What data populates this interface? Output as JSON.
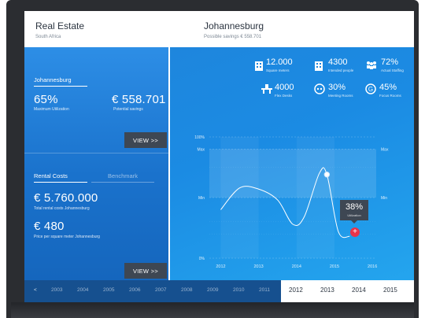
{
  "header": {
    "left_title": "Real Estate",
    "left_sub": "South Africa",
    "right_title": "Johannesburg",
    "right_sub": "Possible savings € 558.701"
  },
  "left": {
    "tab_city": "Johannesburg",
    "max_util_value": "65%",
    "max_util_caption": "Maximum Utilization",
    "savings_value": "€ 558.701",
    "savings_caption": "Potential savings",
    "view_label": "VIEW >>",
    "tab_rental": "Rental Costs",
    "tab_benchmark": "Benchmark",
    "rental_value": "€ 5.760.000",
    "rental_caption": "Total rental costs Johannesburg",
    "sqm_value": "€ 480",
    "sqm_caption": "Price per square meter Johannesburg",
    "view_label2": "VIEW >>"
  },
  "stats": {
    "square_meters_value": "12.000",
    "square_meters_caption": "Square meters",
    "people_value": "4300",
    "people_caption": "Intended people",
    "staffing_value": "72%",
    "staffing_caption": "Actual Staffing",
    "flex_value": "4000",
    "flex_caption": "Flex Desks",
    "meeting_value": "30%",
    "meeting_caption": "Meeting Rooms",
    "focus_value": "45%",
    "focus_caption": "Focus Rooms",
    "icons": [
      "building-icon",
      "building-icon",
      "people-icon",
      "desk-icon",
      "meeting-icon",
      "focus-icon"
    ]
  },
  "tooltip": {
    "value": "38%",
    "label": "Utilization"
  },
  "chart_data": {
    "type": "line",
    "x": [
      2012,
      2013,
      2014,
      2015,
      2016
    ],
    "series": [
      {
        "x": [
          2012,
          2012.5,
          2013,
          2013.5,
          2013.9,
          2014.2,
          2014.6,
          2014.8,
          2015.1,
          2015.4
        ],
        "values": [
          40,
          58,
          57,
          48,
          28,
          34,
          70,
          69,
          22,
          18
        ]
      }
    ],
    "ylim": [
      0,
      100
    ],
    "xlim": [
      2011.7,
      2016.1
    ],
    "xtick_labels": [
      "2012",
      "2013",
      "2014",
      "2015",
      "2016"
    ],
    "ytick_labels_left": [
      "100%",
      "Max",
      "Min",
      "0%"
    ],
    "ytick_labels_right": [
      "Max",
      "Min"
    ],
    "max_band": 90,
    "min_band": 50,
    "highlight_point": {
      "x": 2014.8,
      "y": 69
    },
    "tooltip_point": {
      "x": 2015.4,
      "y": 18
    },
    "grid": true
  },
  "timeline": {
    "back_label": "<",
    "past_years": [
      "2003",
      "2004",
      "2005",
      "2006",
      "2007",
      "2008",
      "2009",
      "2010",
      "2011"
    ],
    "future_years": [
      "2012",
      "2013",
      "2014",
      "2015"
    ]
  }
}
